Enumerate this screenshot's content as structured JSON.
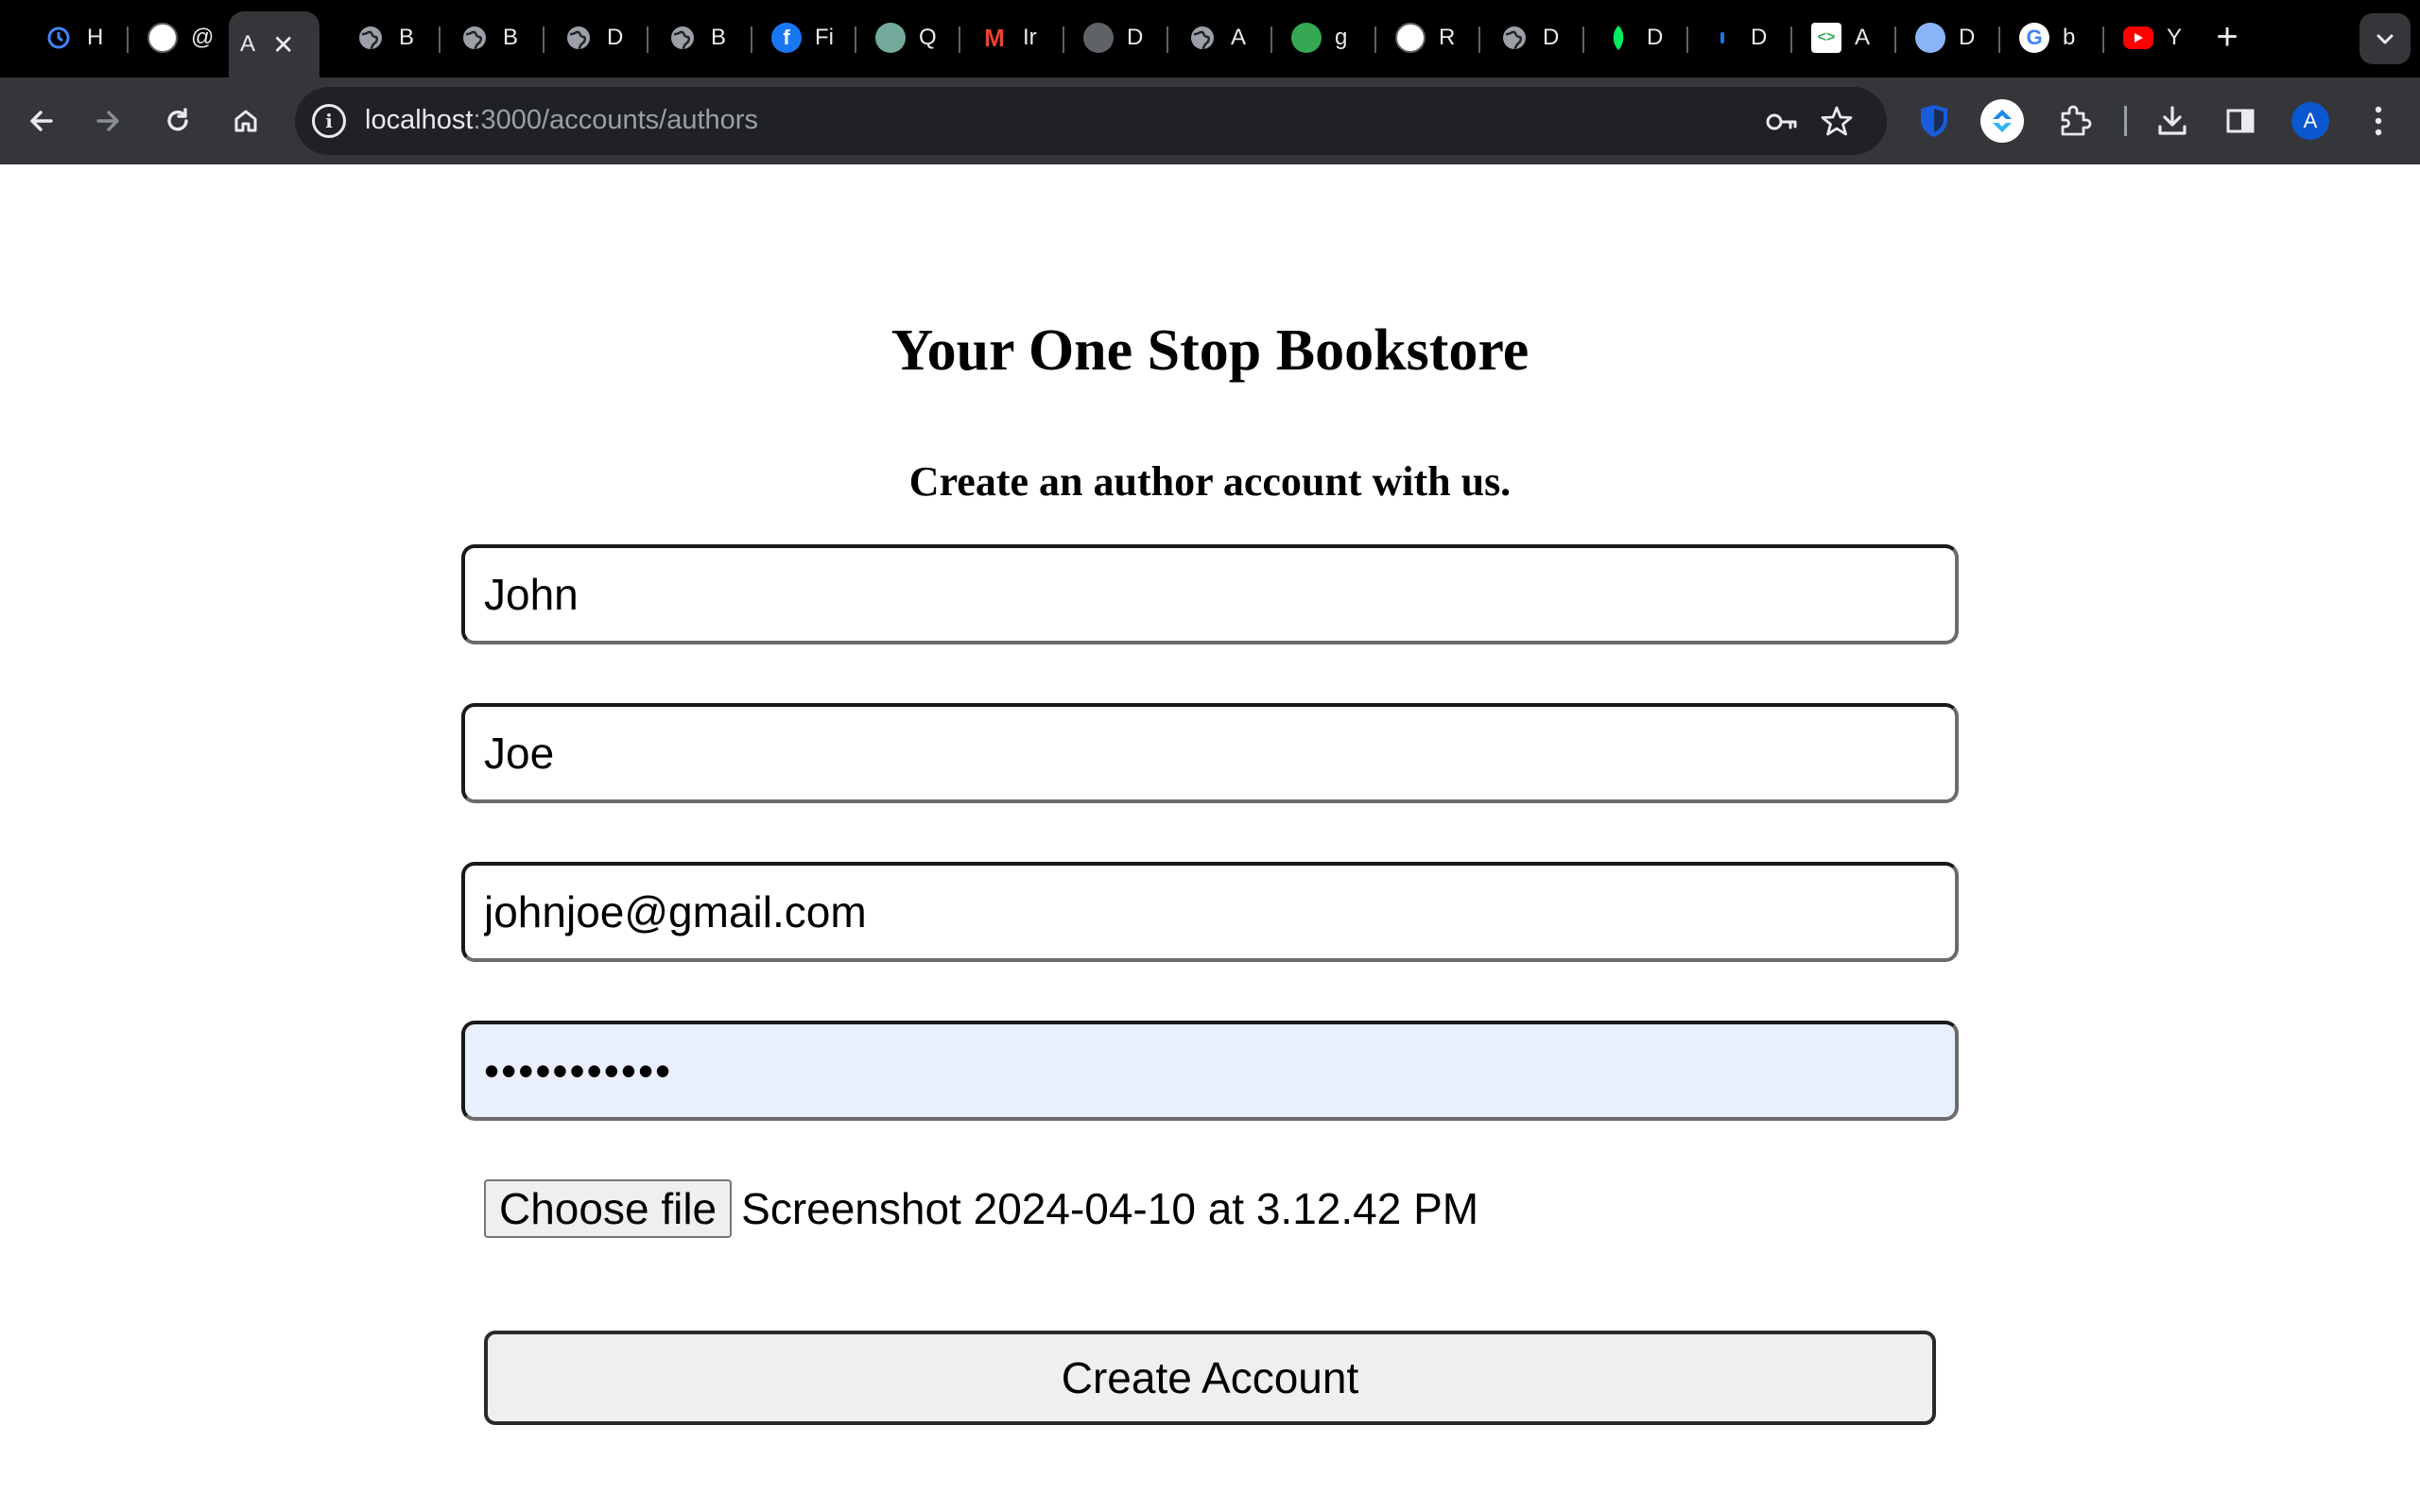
{
  "browser": {
    "tabs": [
      {
        "title": "H",
        "icon": "history-icon",
        "color": "#1a73e8"
      },
      {
        "title": "@",
        "icon": "app-icon",
        "color": "#ffffff"
      },
      {
        "title": "A",
        "icon": "",
        "color": "",
        "active": true
      },
      {
        "title": "B",
        "icon": "globe-icon",
        "color": "#5f6368"
      },
      {
        "title": "B",
        "icon": "globe-icon",
        "color": "#5f6368"
      },
      {
        "title": "D",
        "icon": "globe-icon",
        "color": "#5f6368"
      },
      {
        "title": "B",
        "icon": "globe-icon",
        "color": "#5f6368"
      },
      {
        "title": "Fi",
        "icon": "facebook-icon",
        "color": "#1877f2"
      },
      {
        "title": "Q",
        "icon": "chatgpt-icon",
        "color": "#74aa9c"
      },
      {
        "title": "Ir",
        "icon": "gmail-icon",
        "color": "#ea4335"
      },
      {
        "title": "D",
        "icon": "contacts-icon",
        "color": "#5f6368"
      },
      {
        "title": "A",
        "icon": "globe-icon",
        "color": "#5f6368"
      },
      {
        "title": "g",
        "icon": "check-icon",
        "color": "#34a853"
      },
      {
        "title": "R",
        "icon": "pen-icon",
        "color": "#ffffff"
      },
      {
        "title": "D",
        "icon": "globe-icon",
        "color": "#5f6368"
      },
      {
        "title": "D",
        "icon": "leaf-icon",
        "color": "#00684a"
      },
      {
        "title": "D",
        "icon": "dot-icon",
        "color": "#1a73e8"
      },
      {
        "title": "A",
        "icon": "code-icon",
        "color": "#ffffff"
      },
      {
        "title": "D",
        "icon": "seal-icon",
        "color": "#8ab4f8"
      },
      {
        "title": "b",
        "icon": "google-icon",
        "color": "#ffffff"
      },
      {
        "title": "Y",
        "icon": "youtube-icon",
        "color": "#ff0000"
      }
    ],
    "active_tab_close": "✕",
    "new_tab_symbol": "+",
    "tab_search_symbol": "⌄",
    "url_host": "localhost",
    "url_path": ":3000/accounts/authors",
    "profile_initial": "A"
  },
  "page": {
    "title": "Your One Stop Bookstore",
    "subtitle": "Create an author account with us.",
    "form": {
      "first_name": "John",
      "last_name": "Joe",
      "email": "johnjoe@gmail.com",
      "password_mask": "•••••••••••",
      "file_button_label": "Choose file",
      "file_name": "Screenshot 2024-04-10 at 3.12.42 PM",
      "submit_label": "Create Account"
    }
  }
}
